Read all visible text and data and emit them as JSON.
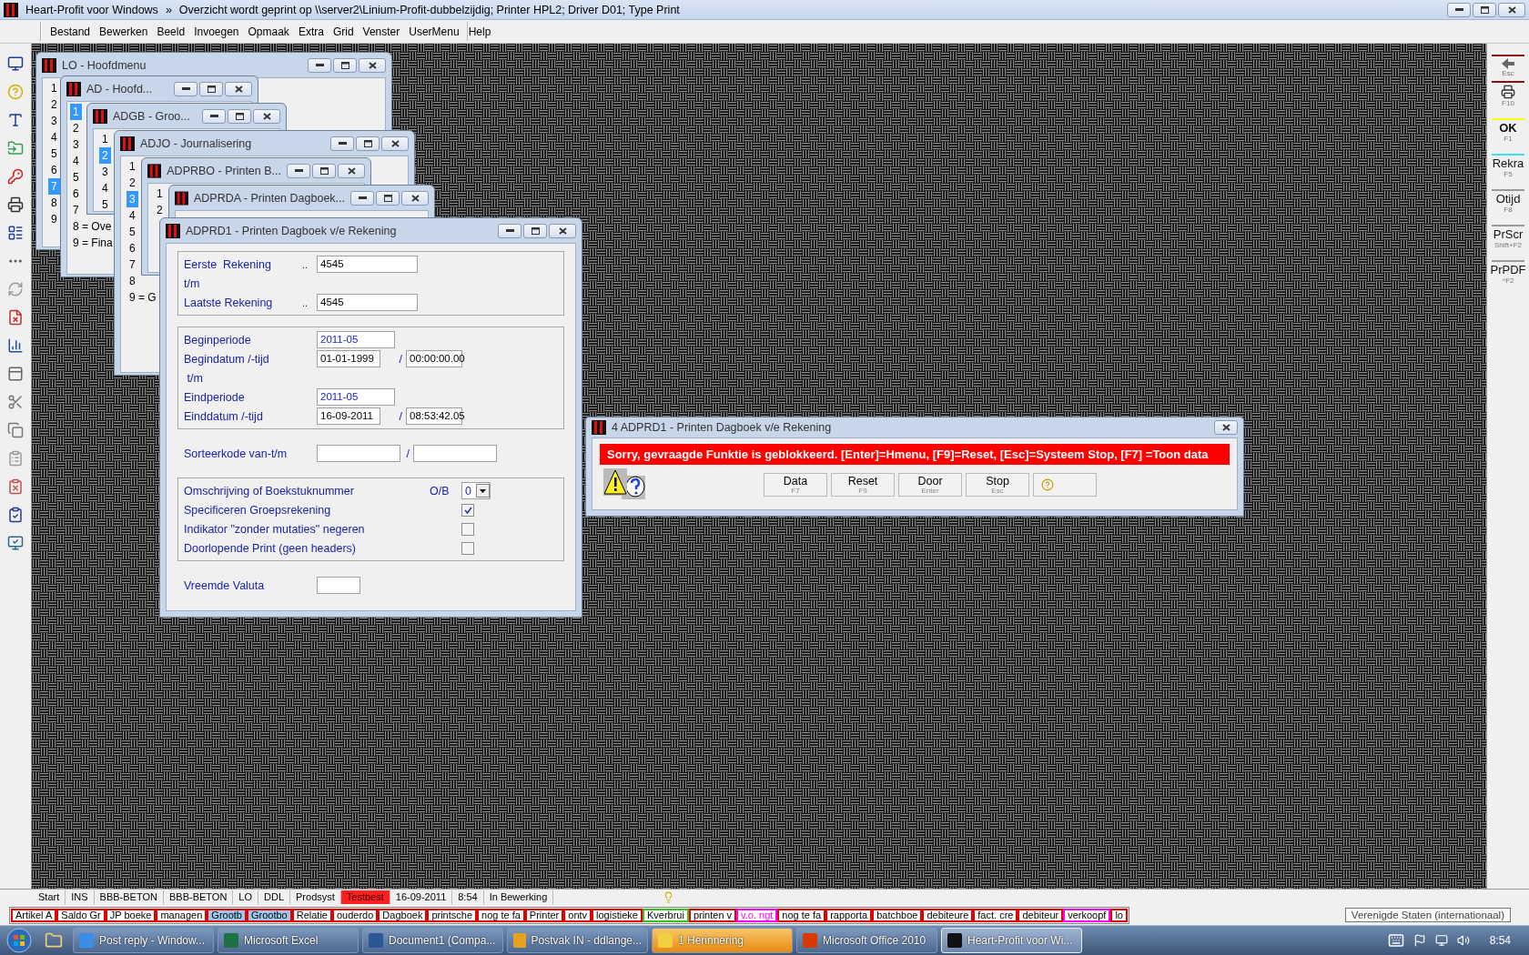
{
  "title_bar": {
    "app": "Heart-Profit voor Windows",
    "separator": "»",
    "message": "Overzicht wordt geprint op \\\\server2\\Linium-Profit-dubbelzijdig; Printer HPL2; Driver D01; Type Print"
  },
  "menu": [
    "Bestand",
    "Bewerken",
    "Beeld",
    "Invoegen",
    "Opmaak",
    "Extra",
    "Grid",
    "Venster",
    "UserMenu",
    "Help"
  ],
  "background_windows": [
    {
      "title": "LO - Hoofdmenu",
      "items": [
        {
          "label": "1",
          "selected": false
        },
        {
          "label": "2",
          "selected": false
        },
        {
          "label": "3",
          "selected": false
        },
        {
          "label": "4",
          "selected": false
        },
        {
          "label": "5",
          "selected": false
        },
        {
          "label": "6",
          "selected": false
        },
        {
          "label": "7",
          "selected": true
        },
        {
          "label": "8",
          "selected": false
        },
        {
          "label": "9",
          "selected": false
        }
      ]
    },
    {
      "title": "AD - Hoofd...",
      "items": [
        {
          "label": "1",
          "selected": true
        },
        {
          "label": "2",
          "selected": false
        },
        {
          "label": "3",
          "selected": false
        },
        {
          "label": "4",
          "selected": false
        },
        {
          "label": "5",
          "selected": false
        },
        {
          "label": "6",
          "selected": false
        },
        {
          "label": "7",
          "selected": false
        },
        {
          "label": "8 = Ove",
          "selected": false
        },
        {
          "label": "9 = Fina",
          "selected": false
        }
      ]
    },
    {
      "title": "ADGB - Groo...",
      "items": [
        {
          "label": "1",
          "selected": false
        },
        {
          "label": "2",
          "selected": true
        },
        {
          "label": "3",
          "selected": false
        },
        {
          "label": "4",
          "selected": false
        },
        {
          "label": "5",
          "selected": false
        }
      ]
    },
    {
      "title": "ADJO - Journalisering",
      "items": [
        {
          "label": "1",
          "selected": false
        },
        {
          "label": "2",
          "selected": false
        },
        {
          "label": "3",
          "selected": true
        },
        {
          "label": "4",
          "selected": false
        },
        {
          "label": "5",
          "selected": false
        },
        {
          "label": "6",
          "selected": false
        },
        {
          "label": "7",
          "selected": false
        },
        {
          "label": "8",
          "selected": false
        },
        {
          "label": "9 = G",
          "selected": false
        }
      ]
    },
    {
      "title": "ADPRBO - Printen B...",
      "items": [
        {
          "label": "1",
          "selected": false
        },
        {
          "label": "2",
          "selected": false
        }
      ]
    },
    {
      "title": "ADPRDA - Printen Dagboek..."
    }
  ],
  "form_window": {
    "title": "ADPRD1 - Printen Dagboek v/e Rekening",
    "groups": [
      {
        "framed": true,
        "rows": [
          {
            "kind": "field",
            "label": "Eerste  Rekening",
            "dots": "..",
            "value": "4545"
          },
          {
            "kind": "text",
            "label": "t/m"
          },
          {
            "kind": "field",
            "label": "Laatste Rekening",
            "dots": "..",
            "value": "4545"
          }
        ]
      },
      {
        "framed": true,
        "rows": [
          {
            "kind": "period",
            "label": "Beginperiode",
            "value": "2011-05"
          },
          {
            "kind": "datetime",
            "label": "Begindatum /-tijd",
            "date": "01-01-1999",
            "separator": "/",
            "time": "00:00:00.00"
          },
          {
            "kind": "text",
            "label": " t/m"
          },
          {
            "kind": "period",
            "label": "Eindperiode",
            "value": "2011-05"
          },
          {
            "kind": "datetime",
            "label": "Einddatum /-tijd",
            "date": "16-09-2011",
            "separator": "/",
            "time": "08:53:42.05"
          }
        ]
      },
      {
        "framed": false,
        "rows": [
          {
            "kind": "range",
            "label": "Sorteerkode van-t/m",
            "separator": "/"
          }
        ]
      },
      {
        "framed": true,
        "rows": [
          {
            "kind": "select",
            "label": "Omschrijving of Boekstuknummer",
            "option_label": "O/B",
            "value": "0"
          },
          {
            "kind": "checkbox",
            "label": "Specificeren Groepsrekening",
            "checked": true
          },
          {
            "kind": "checkbox",
            "label": "Indikator \"zonder mutaties\" negeren",
            "checked": false
          },
          {
            "kind": "checkbox",
            "label": "Doorlopende Print (geen headers)",
            "checked": false
          }
        ]
      },
      {
        "framed": false,
        "rows": [
          {
            "kind": "short",
            "label": "Vreemde Valuta"
          }
        ]
      }
    ]
  },
  "error_dialog": {
    "title": "4 ADPRD1 - Printen Dagboek v/e Rekening",
    "message": "Sorry, gevraagde Funktie is geblokkeerd.  [Enter]=Hmenu, [F9]=Reset, [Esc]=Systeem Stop, [F7] =Toon data",
    "buttons": [
      {
        "kind": "text",
        "label": "Data",
        "key": "F7"
      },
      {
        "kind": "text",
        "label": "Reset",
        "key": "F9"
      },
      {
        "kind": "text",
        "label": "Door",
        "key": "Enter"
      },
      {
        "kind": "text",
        "label": "Stop",
        "key": "Esc"
      },
      {
        "kind": "help"
      }
    ]
  },
  "right_toolbar": [
    {
      "kind": "back",
      "key": "Esc",
      "color": "#8b1010"
    },
    {
      "kind": "printer",
      "key": "F10",
      "color": "#8b1010"
    },
    {
      "kind": "text",
      "label": "OK",
      "key": "F1",
      "color": "#ffff00"
    },
    {
      "kind": "text",
      "label": "Rekra",
      "key": "F5",
      "color": "#40e0f0"
    },
    {
      "kind": "text",
      "label": "Otijd",
      "key": "F8",
      "color": "#9a9a9a"
    },
    {
      "kind": "text",
      "label": "PrScr",
      "key": "Shift+F2",
      "color": "#9a9a9a"
    },
    {
      "kind": "text",
      "label": "PrPDF",
      "key": "^F2",
      "color": "#9a9a9a"
    }
  ],
  "status_bar": [
    {
      "label": "Start",
      "alert": false
    },
    {
      "label": "INS",
      "alert": false
    },
    {
      "label": "BBB-BETON",
      "alert": false
    },
    {
      "label": "BBB-BETON",
      "alert": false
    },
    {
      "label": "LO",
      "alert": false
    },
    {
      "label": "DDL",
      "alert": false
    },
    {
      "label": "Prodsyst",
      "alert": false
    },
    {
      "label": "Testbest",
      "alert": true
    },
    {
      "label": "16-09-2011",
      "alert": false
    },
    {
      "label": "8:54",
      "alert": false
    },
    {
      "label": "In Bewerking",
      "alert": false
    }
  ],
  "quick_tabs": [
    {
      "label": "Artikel A",
      "color": "#e00000",
      "selected": false
    },
    {
      "label": "Saldo Gr",
      "color": "#e00000",
      "selected": false
    },
    {
      "label": "JP boeke",
      "color": "#e00000",
      "selected": false
    },
    {
      "label": "managen",
      "color": "#e00000",
      "selected": false
    },
    {
      "label": "Grootb",
      "color": "#e00000",
      "selected": true
    },
    {
      "label": "Grootbo",
      "color": "#e00000",
      "selected": true
    },
    {
      "label": "Relatie",
      "color": "#e00000",
      "selected": false
    },
    {
      "label": "ouderdo",
      "color": "#e00000",
      "selected": false
    },
    {
      "label": "Dagboek",
      "color": "#e00000",
      "selected": false
    },
    {
      "label": "printsche",
      "color": "#e00000",
      "selected": false
    },
    {
      "label": "nog te fa",
      "color": "#e00000",
      "selected": false
    },
    {
      "label": "Printer",
      "color": "#e00000",
      "selected": false
    },
    {
      "label": "ontv",
      "color": "#e00000",
      "selected": false
    },
    {
      "label": "logistieke",
      "color": "#e00000",
      "selected": false
    },
    {
      "label": "Kverbrui",
      "color": "#40c020",
      "selected": false
    },
    {
      "label": "printen v",
      "color": "#e00000",
      "selected": false
    },
    {
      "label": "v.o. ngt",
      "color": "#ff00ff",
      "selected": false
    },
    {
      "label": "nog te fa",
      "color": "#e00000",
      "selected": false
    },
    {
      "label": "rapporta",
      "color": "#e00000",
      "selected": false
    },
    {
      "label": "batchboe",
      "color": "#e00000",
      "selected": false
    },
    {
      "label": "debiteure",
      "color": "#e00000",
      "selected": false
    },
    {
      "label": "fact. cre",
      "color": "#e00000",
      "selected": false
    },
    {
      "label": "debiteur",
      "color": "#e00000",
      "selected": false
    },
    {
      "label": "verkoopf",
      "color": "#ff00ff",
      "selected": false
    },
    {
      "label": "lo",
      "color": "#e00000",
      "selected": false
    }
  ],
  "tooltip": "Verenigde Staten (internationaal)",
  "taskbar": {
    "buttons": [
      {
        "kind": "browser",
        "label": "Post reply - Window...",
        "selected": false,
        "flashing": false
      },
      {
        "kind": "excel",
        "label": "Microsoft Excel",
        "selected": false,
        "flashing": false
      },
      {
        "kind": "word",
        "label": "Document1 (Compa...",
        "selected": false,
        "flashing": false
      },
      {
        "kind": "outlook",
        "label": "Postvak IN - ddlange...",
        "selected": false,
        "flashing": false
      },
      {
        "kind": "reminder",
        "label": "1 Herinnering",
        "selected": false,
        "flashing": true
      },
      {
        "kind": "office",
        "label": "Microsoft Office 2010",
        "selected": false,
        "flashing": false
      },
      {
        "kind": "app",
        "label": "Heart-Profit voor Wi...",
        "selected": true,
        "flashing": false
      }
    ],
    "clock": "8:54"
  }
}
